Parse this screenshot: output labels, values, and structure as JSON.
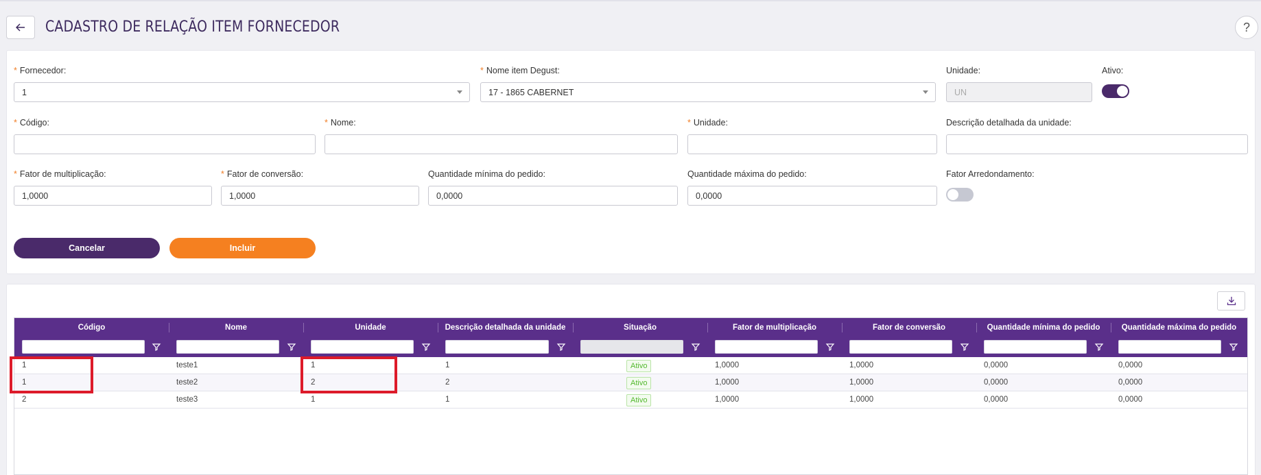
{
  "header": {
    "title": "CADASTRO DE RELAÇÃO ITEM FORNECEDOR",
    "help_label": "?"
  },
  "form": {
    "fornecedor": {
      "label": "Fornecedor",
      "value": "1",
      "required": true
    },
    "nome_item": {
      "label": "Nome item Degust",
      "value": "17 - 1865 CABERNET",
      "required": true
    },
    "unidade_top": {
      "label": "Unidade",
      "value": "UN"
    },
    "ativo": {
      "label": "Ativo",
      "on": true
    },
    "codigo": {
      "label": "Código",
      "value": "",
      "required": true
    },
    "nome": {
      "label": "Nome",
      "value": "",
      "required": true
    },
    "unidade": {
      "label": "Unidade",
      "value": "",
      "required": true
    },
    "descricao_unidade": {
      "label": "Descrição detalhada da unidade",
      "value": ""
    },
    "fator_multiplicacao": {
      "label": "Fator de multiplicação",
      "value": "1,0000",
      "required": true
    },
    "fator_conversao": {
      "label": "Fator de conversão",
      "value": "1,0000",
      "required": true
    },
    "qtd_minima": {
      "label": "Quantidade mínima do pedido",
      "value": "0,0000"
    },
    "qtd_maxima": {
      "label": "Quantidade máxima do pedido",
      "value": "0,0000"
    },
    "fator_arredondamento": {
      "label": "Fator Arredondamento",
      "on": false
    },
    "colon": ":",
    "required_mark": "*",
    "cancel_label": "Cancelar",
    "add_label": "Incluir"
  },
  "grid": {
    "columns": [
      "Código",
      "Nome",
      "Unidade",
      "Descrição detalhada da unidade",
      "Situação",
      "Fator de multiplicação",
      "Fator de conversão",
      "Quantidade mínima do pedido",
      "Quantidade máxima do pedido"
    ],
    "rows": [
      [
        "1",
        "teste1",
        "1",
        "1",
        "Ativo",
        "1,0000",
        "1,0000",
        "0,0000",
        "0,0000"
      ],
      [
        "1",
        "teste2",
        "2",
        "2",
        "Ativo",
        "1,0000",
        "1,0000",
        "0,0000",
        "0,0000"
      ],
      [
        "2",
        "teste3",
        "1",
        "1",
        "Ativo",
        "1,0000",
        "1,0000",
        "0,0000",
        "0,0000"
      ]
    ]
  },
  "colors": {
    "brand_purple": "#4a2a6a",
    "header_purple": "#5a2f8a",
    "accent_orange": "#f58020",
    "status_green": "#52b82c",
    "highlight_red": "#dd1b2a"
  }
}
